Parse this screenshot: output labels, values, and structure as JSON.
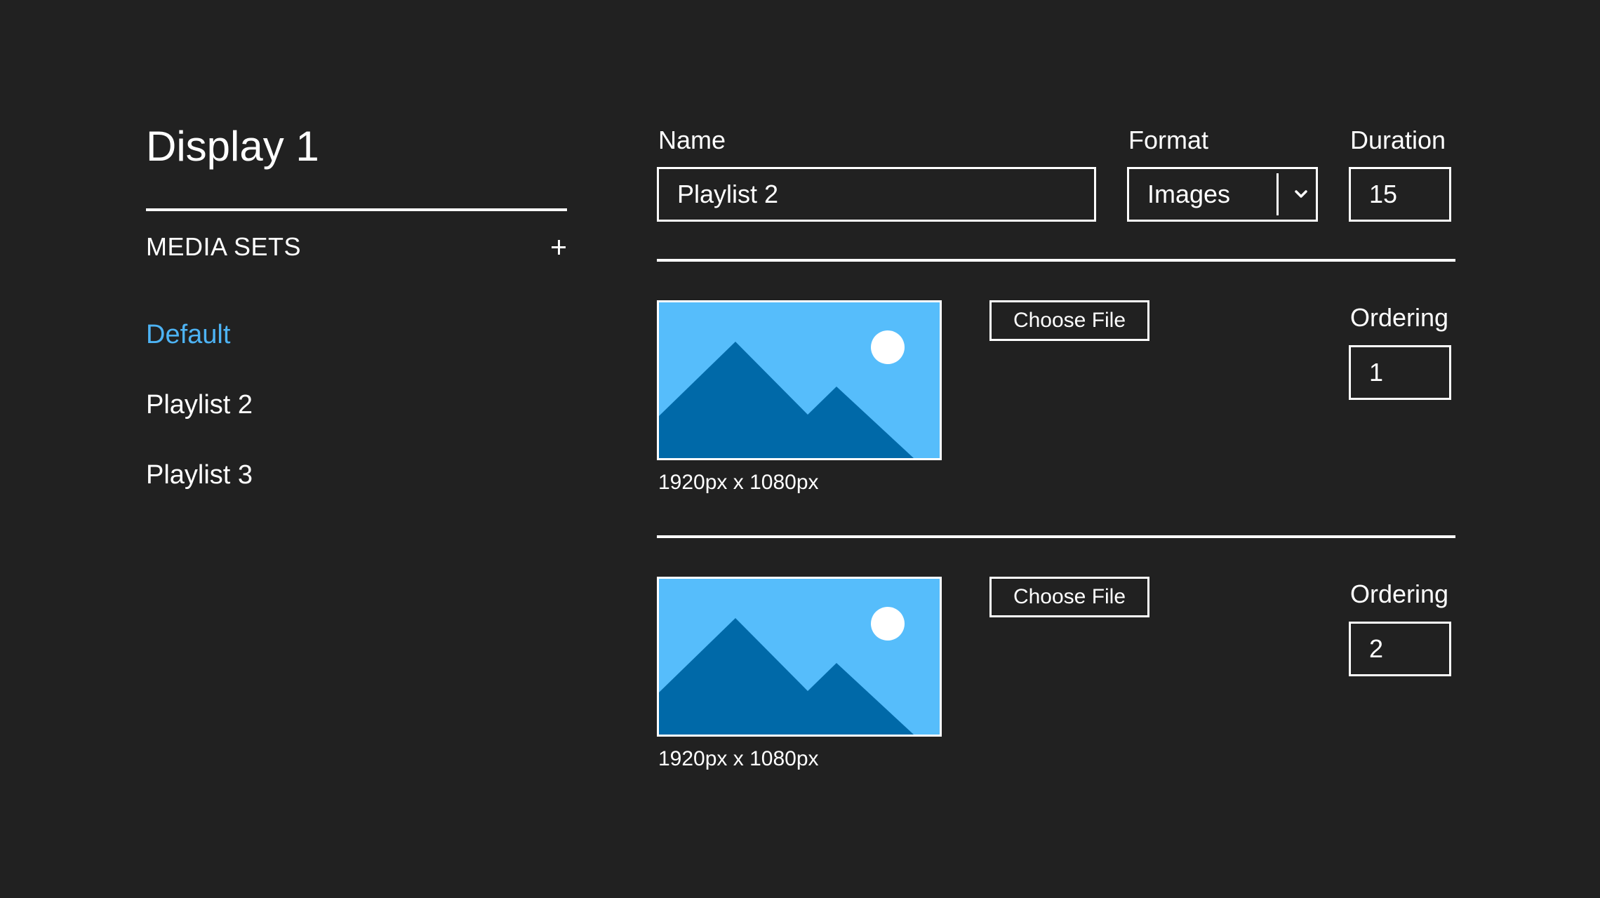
{
  "sidebar": {
    "title": "Display 1",
    "section_label": "MEDIA SETS",
    "items": [
      {
        "label": "Default",
        "active": true
      },
      {
        "label": "Playlist 2",
        "active": false
      },
      {
        "label": "Playlist 3",
        "active": false
      }
    ]
  },
  "form": {
    "name_label": "Name",
    "name_value": "Playlist 2",
    "format_label": "Format",
    "format_value": "Images",
    "duration_label": "Duration",
    "duration_value": "15"
  },
  "media_items": [
    {
      "choose_file_label": "Choose File",
      "ordering_label": "Ordering",
      "ordering_value": "1",
      "dimensions": "1920px x 1080px"
    },
    {
      "choose_file_label": "Choose File",
      "ordering_label": "Ordering",
      "ordering_value": "2",
      "dimensions": "1920px x 1080px"
    }
  ],
  "icons": {
    "add": "plus-icon",
    "dropdown": "chevron-down-icon",
    "thumbnail": "image-placeholder-icon"
  },
  "colors": {
    "background": "#212121",
    "text": "#ffffff",
    "active_item": "#4db3f4",
    "thumbnail_sky": "#56bdfb",
    "thumbnail_mountain": "#0069a8"
  }
}
